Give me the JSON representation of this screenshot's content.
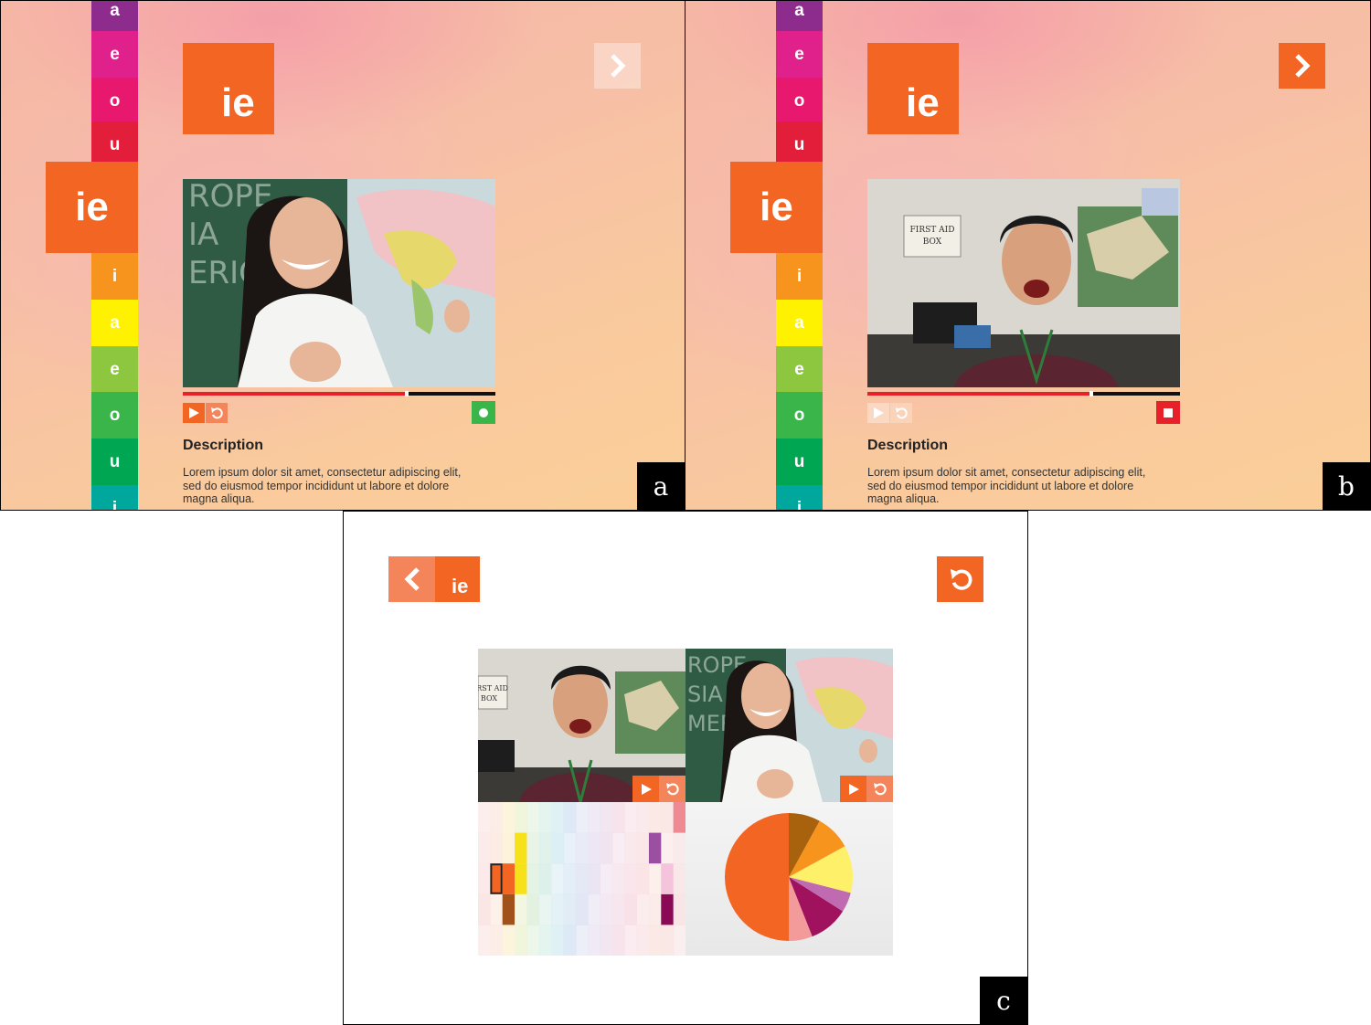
{
  "phoneme": "ie",
  "vowel_strip": [
    {
      "label": "a",
      "color": "#8e2c8e"
    },
    {
      "label": "e",
      "color": "#e0208b"
    },
    {
      "label": "o",
      "color": "#e8186e"
    },
    {
      "label": "u",
      "color": "#e31e3b"
    },
    {
      "label": "ie",
      "color": "#f26522",
      "active": true
    },
    {
      "label": "i",
      "color": "#f7941d"
    },
    {
      "label": "a",
      "color": "#fff200"
    },
    {
      "label": "e",
      "color": "#8dc63f"
    },
    {
      "label": "o",
      "color": "#39b54a"
    },
    {
      "label": "u",
      "color": "#00a651"
    },
    {
      "label": "i",
      "color": "#00a79d"
    }
  ],
  "panel_a": {
    "label": "a",
    "video_subject": "teacher-at-world-map",
    "progress_fraction": 0.71,
    "record_state": "ready",
    "description_title": "Description",
    "description_body": "Lorem ipsum dolor sit amet, consectetur adipiscing elit, sed do eiusmod tempor incididunt ut labore et dolore magna aliqua."
  },
  "panel_b": {
    "label": "b",
    "video_subject": "student-speaking",
    "sign_text": "FIRST AID BOX",
    "progress_fraction": 0.71,
    "record_state": "recording",
    "description_title": "Description",
    "description_body": "Lorem ipsum dolor sit amet, consectetur adipiscing elit, sed do eiusmod tempor incididunt ut labore et dolore magna aliqua."
  },
  "panel_c": {
    "label": "c",
    "left_video": "student-speaking",
    "right_video": "teacher-at-world-map",
    "left_sign_text": "FIRST AID BOX",
    "heatmap_highlight_color": "#f26522",
    "pie_slices": [
      {
        "color": "#f26522",
        "fraction": 0.5
      },
      {
        "color": "#f39a9b",
        "fraction": 0.06
      },
      {
        "color": "#a0115e",
        "fraction": 0.1
      },
      {
        "color": "#c06bb1",
        "fraction": 0.05
      },
      {
        "color": "#fff06a",
        "fraction": 0.12
      },
      {
        "color": "#f7941d",
        "fraction": 0.09
      },
      {
        "color": "#a8620d",
        "fraction": 0.08
      }
    ]
  },
  "icons": {
    "next": "chevron-right-icon",
    "back": "chevron-left-icon",
    "play": "play-icon",
    "replay": "replay-icon",
    "record": "record-icon",
    "stop": "stop-icon"
  },
  "colors": {
    "accent": "#f26522",
    "record_green": "#39b54a",
    "stop_red": "#e8202a"
  }
}
